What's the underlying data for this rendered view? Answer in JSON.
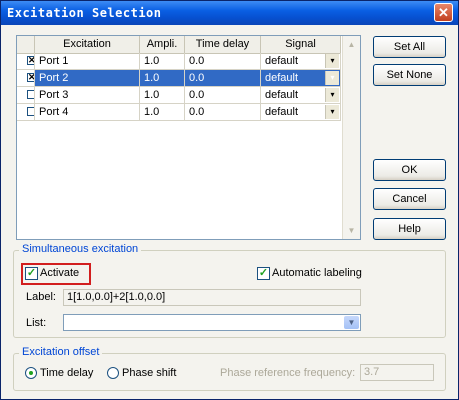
{
  "window": {
    "title": "Excitation Selection",
    "close_glyph": "✕"
  },
  "grid": {
    "headers": [
      "",
      "Excitation",
      "Ampli.",
      "Time delay",
      "Signal"
    ],
    "rows": [
      {
        "checked": true,
        "check_glyph": "✕",
        "port": "Port 1",
        "ampli": "1.0",
        "delay": "0.0",
        "signal": "default",
        "selected": false
      },
      {
        "checked": true,
        "check_glyph": "✕",
        "port": "Port 2",
        "ampli": "1.0",
        "delay": "0.0",
        "signal": "default",
        "selected": true
      },
      {
        "checked": false,
        "check_glyph": "",
        "port": "Port 3",
        "ampli": "1.0",
        "delay": "0.0",
        "signal": "default",
        "selected": false
      },
      {
        "checked": false,
        "check_glyph": "",
        "port": "Port 4",
        "ampli": "1.0",
        "delay": "0.0",
        "signal": "default",
        "selected": false
      }
    ],
    "dropdown_glyph": "▾",
    "scroll_up_glyph": "▲",
    "scroll_down_glyph": "▼"
  },
  "buttons": {
    "set_all": "Set All",
    "set_none": "Set None",
    "ok": "OK",
    "cancel": "Cancel",
    "help": "Help"
  },
  "simultaneous": {
    "title": "Simultaneous excitation",
    "activate_label": "Activate",
    "activate_checked": true,
    "auto_label": "Automatic labeling",
    "auto_checked": true,
    "check_glyph": "✓",
    "label_caption": "Label:",
    "label_value": "1[1.0,0.0]+2[1.0,0.0]",
    "list_caption": "List:",
    "list_value": "",
    "combo_glyph": "▼"
  },
  "offset": {
    "title": "Excitation offset",
    "time_delay_label": "Time delay",
    "phase_shift_label": "Phase shift",
    "selected": "time_delay",
    "ref_freq_label": "Phase reference frequency:",
    "ref_freq_value": "3.7"
  },
  "colors": {
    "title_bar": "#0a5fe3",
    "selection": "#316ac5",
    "group_title": "#0046d5",
    "highlight": "#d21e1e",
    "check": "#21a121"
  }
}
